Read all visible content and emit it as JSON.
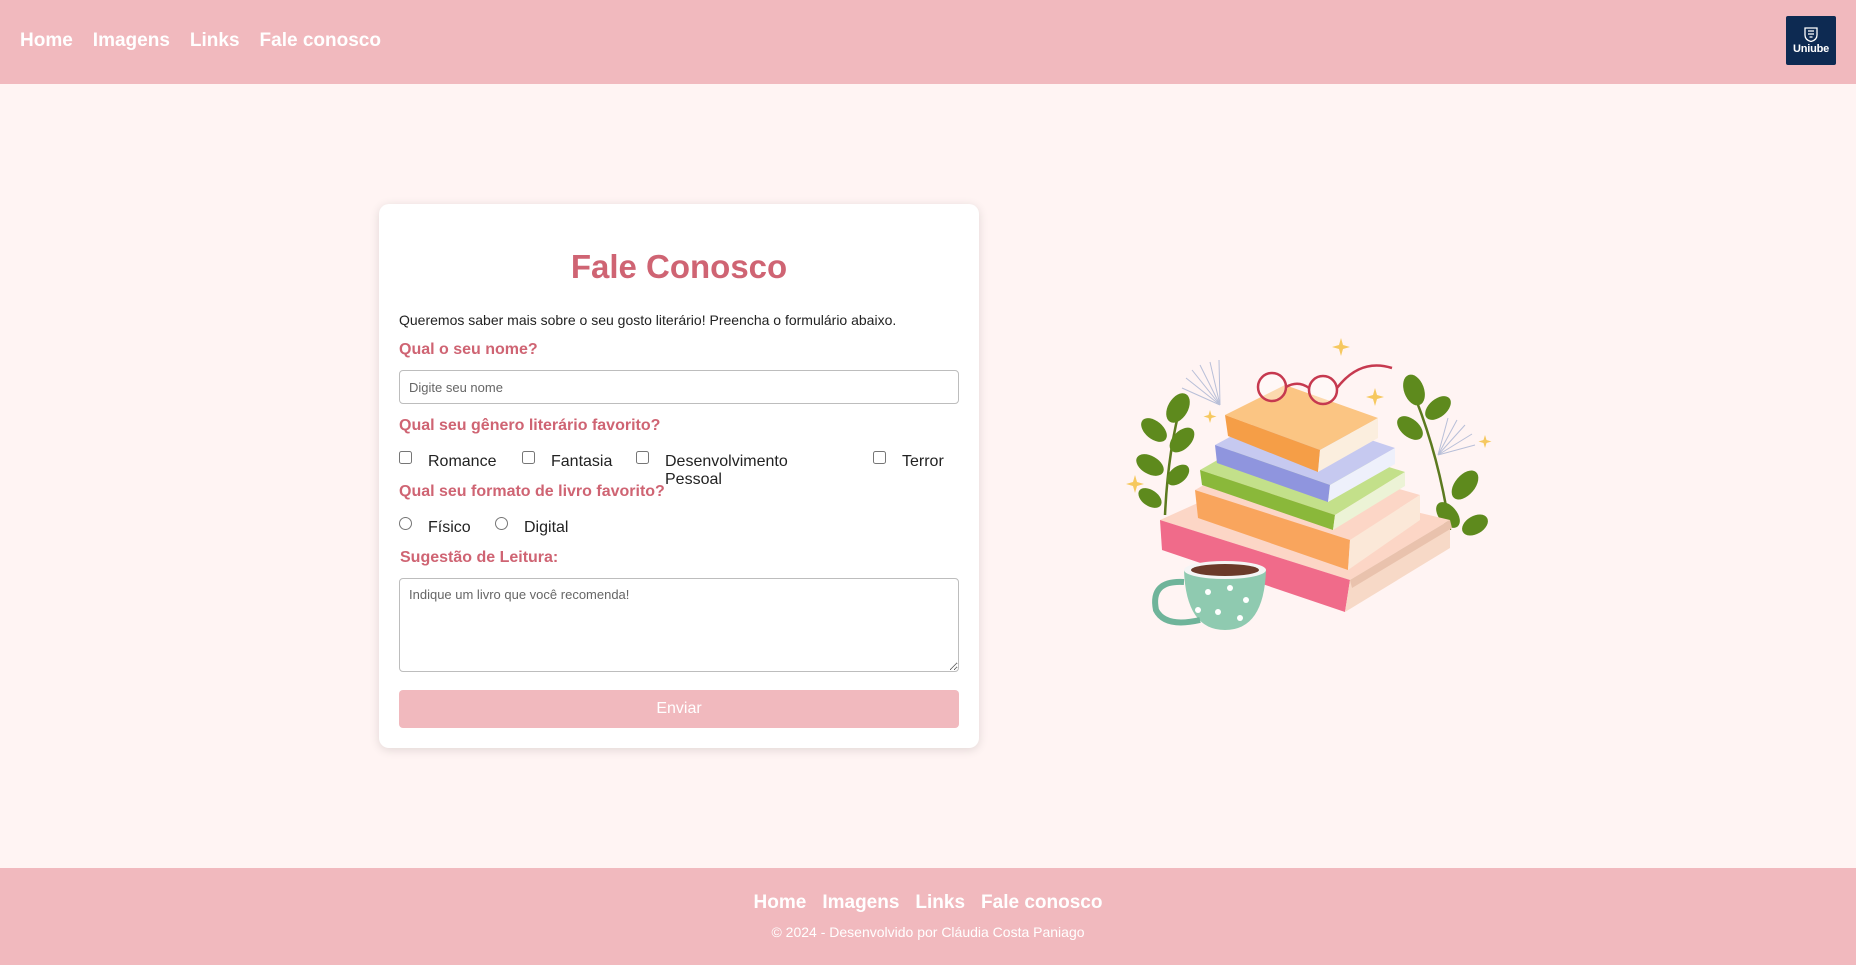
{
  "header": {
    "nav": [
      "Home",
      "Imagens",
      "Links",
      "Fale conosco"
    ],
    "logo_text": "Uniube"
  },
  "form": {
    "title": "Fale Conosco",
    "intro": "Queremos saber mais sobre o seu gosto literário! Preencha o formulário abaixo.",
    "name_question": "Qual o seu nome?",
    "name_placeholder": "Digite seu nome",
    "name_value": "",
    "genre_question": "Qual seu gênero literário favorito?",
    "genres": [
      "Romance",
      "Fantasia",
      "Desenvolvimento Pessoal",
      "Terror"
    ],
    "format_question": "Qual seu formato de livro favorito?",
    "formats": [
      "Físico",
      "Digital"
    ],
    "suggestion_label": "Sugestão de Leitura:",
    "suggestion_placeholder": "Indique um livro que você recomenda!",
    "submit_label": "Enviar"
  },
  "footer": {
    "nav": [
      "Home",
      "Imagens",
      "Links",
      "Fale conosco"
    ],
    "copyright": "© 2024 - Desenvolvido por Cláudia Costa Paniago"
  },
  "colors": {
    "header_bg": "#f1b9be",
    "page_bg": "#fff4f3",
    "accent": "#cf6473",
    "logo_bg": "#0d2a52"
  },
  "icons": {
    "logo": "uniube-crest-icon",
    "illustration": "stacked-books-with-coffee-cup-and-glasses"
  }
}
